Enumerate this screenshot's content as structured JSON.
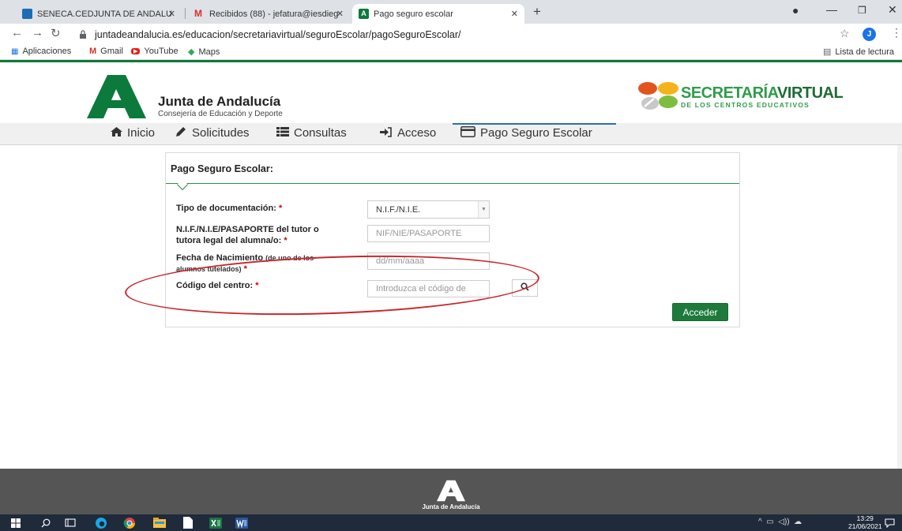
{
  "browser": {
    "tabs": [
      {
        "title": "SENECA.CEDJUNTA DE ANDALU",
        "favicon": "seneca-icon"
      },
      {
        "title": "Recibidos (88) - jefatura@iesdieg",
        "favicon": "gmail-icon"
      },
      {
        "title": "Pago seguro escolar",
        "favicon": "junta-icon",
        "active": true
      }
    ],
    "url": "juntadeandalucia.es/educacion/secretariavirtual/seguroEscolar/pagoSeguroEscolar/",
    "profile_initial": "J",
    "bookmarks": [
      "Aplicaciones",
      "Gmail",
      "YouTube",
      "Maps"
    ],
    "reading_list": "Lista de lectura"
  },
  "header": {
    "title": "Junta de Andalucía",
    "subtitle": "Consejería de Educación y Deporte",
    "sv_title_a": "SECRETARÍA",
    "sv_title_b": "VIRTUAL",
    "sv_subtitle": "DE LOS CENTROS EDUCATIVOS"
  },
  "nav": {
    "items": [
      "Inicio",
      "Solicitudes",
      "Consultas",
      "Acceso",
      "Pago Seguro Escolar"
    ]
  },
  "form": {
    "title": "Pago Seguro Escolar:",
    "doc_type_label": "Tipo de documentación:",
    "doc_type_value": "N.I.F./N.I.E.",
    "id_label_line1": "N.I.F./N.I.E/PASAPORTE del tutor o",
    "id_label_line2": "tutora legal del alumna/o:",
    "id_placeholder": "NIF/NIE/PASAPORTE",
    "birth_label": "Fecha de Nacimiento",
    "birth_label_small": "(de uno de los",
    "birth_label_line2": "alumnos tutelados)",
    "birth_placeholder": "dd/mm/aaaa",
    "center_label": "Código del centro:",
    "center_placeholder": "Introduzca el código de",
    "required_mark": "*",
    "submit_label": "Acceder"
  },
  "footer": {
    "label": "Junta de Andalucía"
  },
  "taskbar": {
    "time": "13:29",
    "date": "21/06/2021"
  }
}
